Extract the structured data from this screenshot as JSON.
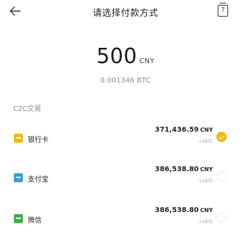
{
  "header": {
    "title": "请选择付款方式",
    "back_icon": "arrow-left-icon",
    "help_icon": "help-document-icon",
    "help_glyph": "?"
  },
  "amount": {
    "value": "500",
    "currency": "CNY",
    "btc_equivalent": "0.001346 BTC"
  },
  "section": {
    "label": "C2C交易"
  },
  "payment_methods": [
    {
      "label": "银行卡",
      "icon": "bank-card-icon",
      "icon_color": "#f0b90b",
      "price": "371,436.59",
      "price_unit": "CNY",
      "sub": "≈1BTC",
      "selected": true
    },
    {
      "label": "支付宝",
      "icon": "alipay-icon",
      "icon_color": "#2f9fe3",
      "price": "386,538.80",
      "price_unit": "CNY",
      "sub": "≈1BTC",
      "selected": false
    },
    {
      "label": "微信",
      "icon": "wechat-icon",
      "icon_color": "#3bb34a",
      "price": "386,538.80",
      "price_unit": "CNY",
      "sub": "≈1BTC",
      "selected": false
    }
  ],
  "colors": {
    "accent": "#f0b90b",
    "muted_text": "#8a8a8a"
  }
}
